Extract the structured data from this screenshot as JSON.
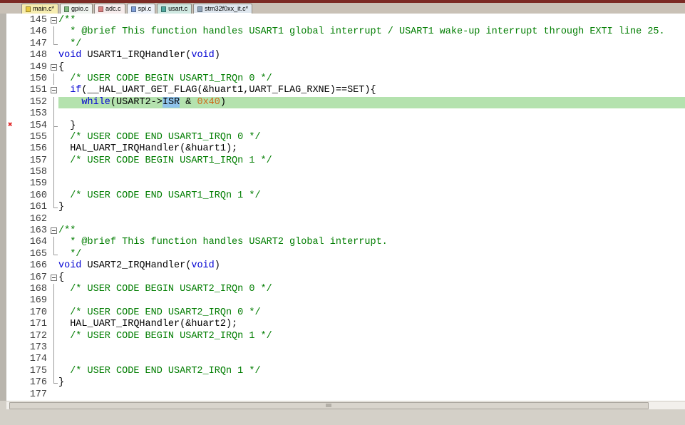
{
  "window": {
    "top_strip_color": "#7c2a24",
    "bg": "#d4d0c8"
  },
  "colors": {
    "kw": "#0000d2",
    "com": "#007d00",
    "num": "#cd6a1a",
    "pl": "#000000",
    "hl": "#b4e2ae",
    "selbg": "#8fc3ea",
    "gnum": "#3f3f3f",
    "err": "#e02020",
    "editorbg": "#ffffff"
  },
  "tab_bar": {
    "bg": "#c9c1b6",
    "tabs": [
      {
        "label": "main.c*",
        "icon_color": "#e8c93e",
        "bg": "#f6ecb0",
        "active": false
      },
      {
        "label": "gpio.c",
        "icon_color": "#7fba7f",
        "bg": "#eff3ef",
        "active": false
      },
      {
        "label": "adc.c",
        "icon_color": "#d97f7f",
        "bg": "#f6ecec",
        "active": false
      },
      {
        "label": "spi.c",
        "icon_color": "#7f9fd9",
        "bg": "#edf2f9",
        "active": false
      },
      {
        "label": "usart.c",
        "icon_color": "#4fa89e",
        "bg": "#cfe8e1",
        "active": false
      },
      {
        "label": "stm32f0xx_it.c*",
        "icon_color": "#8fa3b8",
        "bg": "#dfe7ef",
        "active": true
      }
    ]
  },
  "editor": {
    "selected_word": "ISR",
    "error_icon": "✖",
    "lines": [
      {
        "n": 145,
        "fold": "box",
        "seg": [
          {
            "t": "/**",
            "c": "com"
          }
        ]
      },
      {
        "n": 146,
        "fold": "line",
        "seg": [
          {
            "t": "  * @brief This function handles USART1 global interrupt / USART1 wake-up interrupt through EXTI line 25.",
            "c": "com"
          }
        ]
      },
      {
        "n": 147,
        "fold": "end",
        "seg": [
          {
            "t": "  */",
            "c": "com"
          }
        ]
      },
      {
        "n": 148,
        "fold": "",
        "seg": [
          {
            "t": "void",
            "c": "kw"
          },
          {
            "t": " USART1_IRQHandler(",
            "c": "pl"
          },
          {
            "t": "void",
            "c": "kw"
          },
          {
            "t": ")",
            "c": "pl"
          }
        ]
      },
      {
        "n": 149,
        "fold": "box",
        "seg": [
          {
            "t": "{",
            "c": "pl"
          }
        ]
      },
      {
        "n": 150,
        "fold": "line",
        "seg": [
          {
            "t": "  ",
            "c": "pl"
          },
          {
            "t": "/* USER CODE BEGIN USART1_IRQn 0 */",
            "c": "com"
          }
        ]
      },
      {
        "n": 151,
        "fold": "box",
        "seg": [
          {
            "t": "  ",
            "c": "pl"
          },
          {
            "t": "if",
            "c": "kw"
          },
          {
            "t": "(__HAL_UART_GET_FLAG(&huart1,UART_FLAG_RXNE)==SET){",
            "c": "pl"
          }
        ]
      },
      {
        "n": 152,
        "fold": "line",
        "hl": true,
        "seg": [
          {
            "t": "    ",
            "c": "pl"
          },
          {
            "t": "while",
            "c": "kw"
          },
          {
            "t": "(USART2->",
            "c": "pl"
          },
          {
            "t": "ISR",
            "c": "sel"
          },
          {
            "t": " & ",
            "c": "pl"
          },
          {
            "t": "0x40",
            "c": "num"
          },
          {
            "t": ")",
            "c": "pl"
          }
        ]
      },
      {
        "n": 153,
        "fold": "line",
        "seg": []
      },
      {
        "n": 154,
        "fold": "end2",
        "err": true,
        "seg": [
          {
            "t": "  }",
            "c": "pl"
          }
        ]
      },
      {
        "n": 155,
        "fold": "line",
        "seg": [
          {
            "t": "  ",
            "c": "pl"
          },
          {
            "t": "/* USER CODE END USART1_IRQn 0 */",
            "c": "com"
          }
        ]
      },
      {
        "n": 156,
        "fold": "line",
        "seg": [
          {
            "t": "  HAL_UART_IRQHandler(&huart1);",
            "c": "pl"
          }
        ]
      },
      {
        "n": 157,
        "fold": "line",
        "seg": [
          {
            "t": "  ",
            "c": "pl"
          },
          {
            "t": "/* USER CODE BEGIN USART1_IRQn 1 */",
            "c": "com"
          }
        ]
      },
      {
        "n": 158,
        "fold": "line",
        "seg": []
      },
      {
        "n": 159,
        "fold": "line",
        "seg": []
      },
      {
        "n": 160,
        "fold": "line",
        "seg": [
          {
            "t": "  ",
            "c": "pl"
          },
          {
            "t": "/* USER CODE END USART1_IRQn 1 */",
            "c": "com"
          }
        ]
      },
      {
        "n": 161,
        "fold": "end",
        "seg": [
          {
            "t": "}",
            "c": "pl"
          }
        ]
      },
      {
        "n": 162,
        "fold": "",
        "seg": []
      },
      {
        "n": 163,
        "fold": "box",
        "seg": [
          {
            "t": "/**",
            "c": "com"
          }
        ]
      },
      {
        "n": 164,
        "fold": "line",
        "seg": [
          {
            "t": "  * @brief This function handles USART2 global interrupt.",
            "c": "com"
          }
        ]
      },
      {
        "n": 165,
        "fold": "end",
        "seg": [
          {
            "t": "  */",
            "c": "com"
          }
        ]
      },
      {
        "n": 166,
        "fold": "",
        "seg": [
          {
            "t": "void",
            "c": "kw"
          },
          {
            "t": " USART2_IRQHandler(",
            "c": "pl"
          },
          {
            "t": "void",
            "c": "kw"
          },
          {
            "t": ")",
            "c": "pl"
          }
        ]
      },
      {
        "n": 167,
        "fold": "box",
        "seg": [
          {
            "t": "{",
            "c": "pl"
          }
        ]
      },
      {
        "n": 168,
        "fold": "line",
        "seg": [
          {
            "t": "  ",
            "c": "pl"
          },
          {
            "t": "/* USER CODE BEGIN USART2_IRQn 0 */",
            "c": "com"
          }
        ]
      },
      {
        "n": 169,
        "fold": "line",
        "seg": []
      },
      {
        "n": 170,
        "fold": "line",
        "seg": [
          {
            "t": "  ",
            "c": "pl"
          },
          {
            "t": "/* USER CODE END USART2_IRQn 0 */",
            "c": "com"
          }
        ]
      },
      {
        "n": 171,
        "fold": "line",
        "seg": [
          {
            "t": "  HAL_UART_IRQHandler(&huart2);",
            "c": "pl"
          }
        ]
      },
      {
        "n": 172,
        "fold": "line",
        "seg": [
          {
            "t": "  ",
            "c": "pl"
          },
          {
            "t": "/* USER CODE BEGIN USART2_IRQn 1 */",
            "c": "com"
          }
        ]
      },
      {
        "n": 173,
        "fold": "line",
        "seg": []
      },
      {
        "n": 174,
        "fold": "line",
        "seg": []
      },
      {
        "n": 175,
        "fold": "line",
        "seg": [
          {
            "t": "  ",
            "c": "pl"
          },
          {
            "t": "/* USER CODE END USART2_IRQn 1 */",
            "c": "com"
          }
        ]
      },
      {
        "n": 176,
        "fold": "end",
        "seg": [
          {
            "t": "}",
            "c": "pl"
          }
        ]
      },
      {
        "n": 177,
        "fold": "",
        "seg": []
      }
    ]
  },
  "scrollbar": {
    "thumb_left_pct": 0.4,
    "thumb_width_pct": 94
  }
}
